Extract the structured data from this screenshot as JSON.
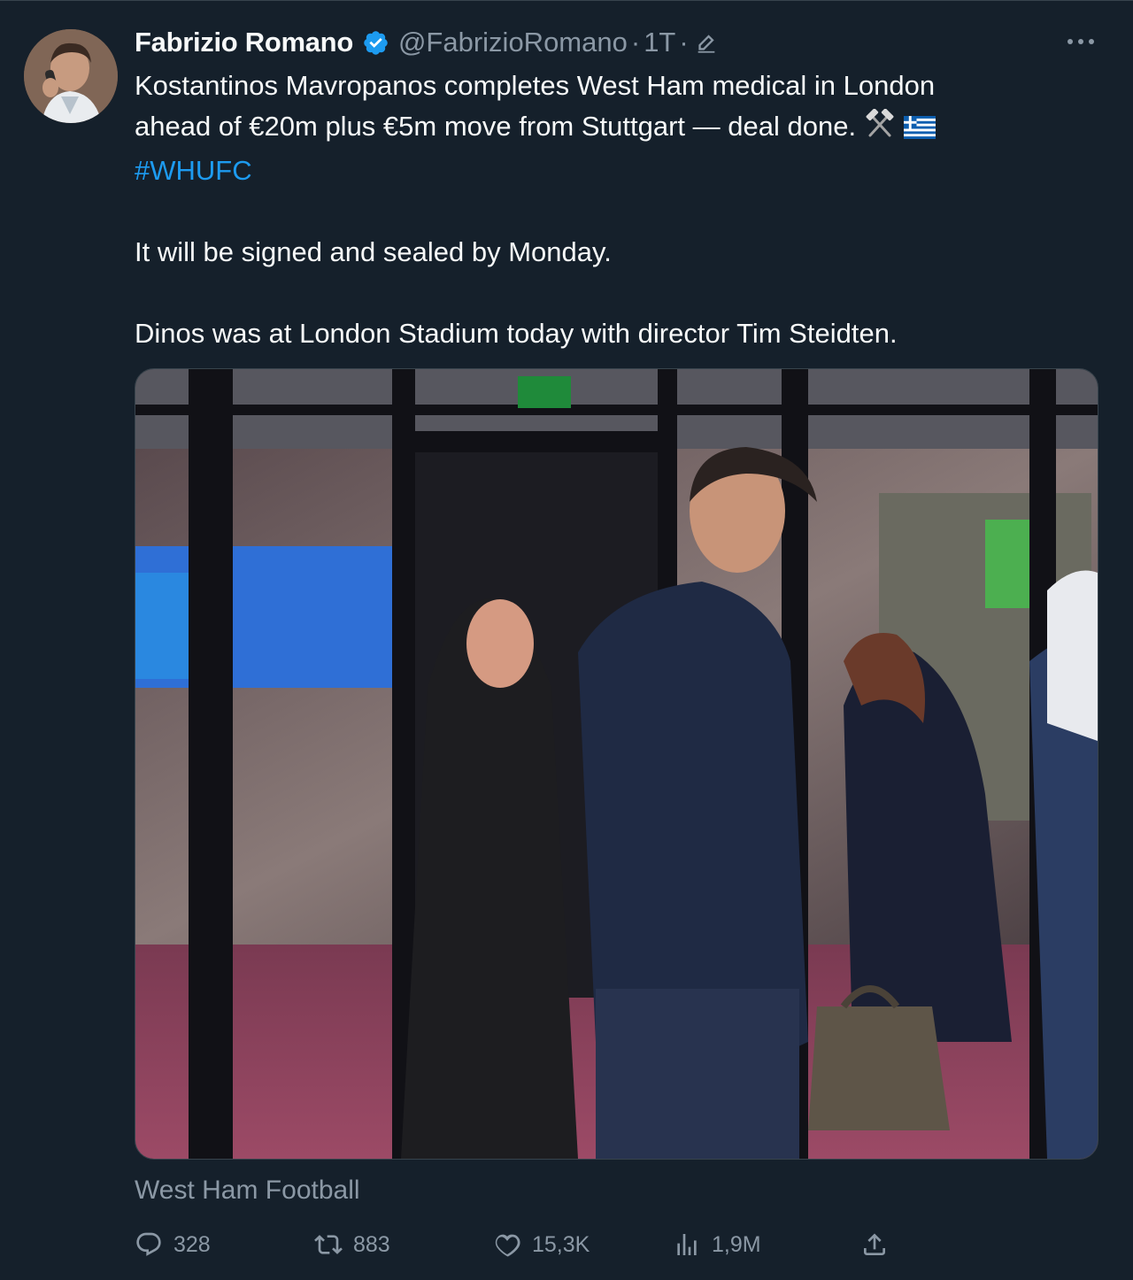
{
  "tweet": {
    "author_name": "Fabrizio Romano",
    "handle": "@FabrizioRomano",
    "separator": "·",
    "time": "1T",
    "text_line1": "Kostantinos Mavropanos completes West Ham medical in London",
    "text_line2": "ahead of €20m plus €5m move from Stuttgart — deal done.",
    "hashtag": "#WHUFC",
    "text_paragraph2": "It will be signed and sealed by Monday.",
    "text_paragraph3": "Dinos was at London Stadium today with director Tim Steidten.",
    "source": "West Ham Football"
  },
  "stats": {
    "replies": "328",
    "retweets": "883",
    "likes": "15,3K",
    "views": "1,9M"
  },
  "icons": {
    "verified": "verified-badge-icon",
    "edited": "edit-pencil-icon",
    "more": "more-dots-icon",
    "reply": "reply-icon",
    "retweet": "retweet-icon",
    "like": "heart-icon",
    "views": "views-bar-icon",
    "share": "share-icon"
  },
  "colors": {
    "background": "#15202b",
    "text_primary": "#f7f9f9",
    "text_secondary": "#8b98a5",
    "link": "#1d9bf0",
    "border": "#38444d"
  }
}
